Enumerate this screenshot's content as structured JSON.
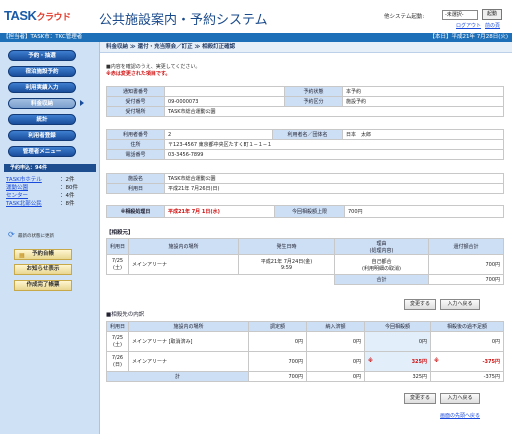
{
  "header": {
    "logo_main": "TASK",
    "logo_sub": "クラウド",
    "title": "公共施設案内・予約システム",
    "system_label": "他システム起動:",
    "system_select": "-未選択-",
    "launch_button": "起動",
    "logout": "ログアウト",
    "prev_screen": "前の頁"
  },
  "status": {
    "left": "【担当者】TASK市：TKC管理者",
    "right": "【本日】平成21年 7月28日(火)"
  },
  "sidebar": {
    "menu": [
      {
        "label": "予約・抽選"
      },
      {
        "label": "宿泊施設予約"
      },
      {
        "label": "利用実績入力"
      },
      {
        "label": "料金収納"
      },
      {
        "label": "統計"
      },
      {
        "label": "利用者登録"
      },
      {
        "label": "管理者メニュー"
      }
    ],
    "mini_head": "予約申込：94件",
    "mini_items": [
      {
        "name": "TASK市ホテル",
        "count": "：2件"
      },
      {
        "name": "運動公園",
        "count": "：80件"
      },
      {
        "name": "センター",
        "count": "：4件"
      },
      {
        "name": "TASK北部公民",
        "count": "：8件"
      }
    ],
    "refresh_label": "最新の状態に更新",
    "buttons": [
      {
        "label": "予約台帳"
      },
      {
        "label": "お知らせ表示"
      },
      {
        "label": "作成完了帳票"
      }
    ]
  },
  "main": {
    "breadcrumb": "料金収納 ≫ 還付・充当照会／訂正 ≫ 相殺訂正確認",
    "note1": "■内容を確認のうえ、実更してください。",
    "note2": "※赤は変更された項目です。",
    "info1": {
      "notice_no_label": "通知書番号",
      "notice_no": "",
      "status_label": "予約状態",
      "status": "本予約",
      "accept_no_label": "受付番号",
      "accept_no": "09-0000073",
      "category_label": "予約区分",
      "category": "施設予約",
      "place_label": "受付場所",
      "place": "TASK市総合運動公園"
    },
    "info2": {
      "user_no_label": "利用者番号",
      "user_no": "2",
      "name_label": "利用者名／団体名",
      "name": "日本　太郎",
      "address_label": "住所",
      "address": "〒123-4567  東京都中央区たすく町１−１−１",
      "phone_label": "電話番号",
      "phone": "03-3456-7899"
    },
    "info3": {
      "facility_label": "施設名",
      "facility": "TASK市総合運動公園",
      "date_label": "利用日",
      "date": "平成21年 7月26日(日)"
    },
    "offset": {
      "date_label": "※相殺処理日",
      "date": "平成21年 7月 1日(水)",
      "limit_label": "今回相殺額上限",
      "limit": "700円"
    },
    "origin_title": "【相殺元】",
    "origin_headers": [
      "利用日",
      "施設内の場所",
      "発生日時",
      "理由\n(処理内容)",
      "還付額合計"
    ],
    "origin_rows": [
      {
        "date": "7/25\n(土)",
        "place": "メインアリーナ",
        "occurred": "平成21年 7月24日(金)\n9:59",
        "reason": "自己都合\n(利用明細の取消)",
        "amount": "700円"
      }
    ],
    "origin_total_label": "合計",
    "origin_total": "700円",
    "btn_change": "変更する",
    "btn_back": "入力へ戻る",
    "dest_title": "■相殺先の内訳",
    "dest_headers": [
      "利用日",
      "施設内の場所",
      "調定額",
      "納入済額",
      "今回相殺額",
      "相殺後の過不足額"
    ],
    "dest_rows": [
      {
        "date": "7/25\n(土)",
        "place": "メインアリーナ [取消済み]",
        "charge": "0円",
        "paid": "0円",
        "offset": "0円",
        "balance": "0円",
        "mark": ""
      },
      {
        "date": "7/26\n(日)",
        "place": "メインアリーナ",
        "charge": "700円",
        "paid": "0円",
        "offset": "325円",
        "balance": "-375円",
        "mark": "※"
      }
    ],
    "dest_total_label": "計",
    "dest_total": {
      "charge": "700円",
      "paid": "0円",
      "offset": "325円",
      "balance": "-375円"
    },
    "top_link": "画面の先頭へ戻る"
  }
}
